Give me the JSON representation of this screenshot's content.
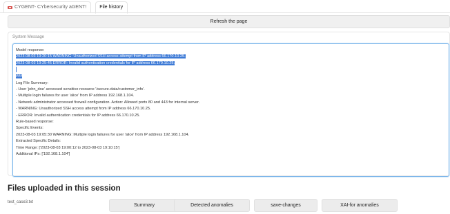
{
  "tabs": [
    {
      "label": "CYGENT- CYbersecurity aGENT!"
    },
    {
      "label": "File history"
    }
  ],
  "refresh": {
    "label": "Refresh the page"
  },
  "system_message": {
    "label": "System Message",
    "lines": [
      "Model response:",
      "2023-08-03 19:20:15 WARNING: Unauthorized SSH access attempt from IP address 66.170.10.25.",
      "2023-08-03 19:25:45 ERROR: Invalid authentication credentials for IP address 66.170.10.25.",
      "",
      "###",
      "",
      "Log File Summary:",
      "- User 'john_doe' accessed sensitive resource '/secure-data/customer_info'.",
      "- Multiple login failures for user 'alice' from IP address 192.168.1.104.",
      "- Network administrator accessed firewall configuration. Action: Allowed ports 80 and 443 for internal server.",
      "- WARNING: Unauthorized SSH access attempt from IP address 66.170.10.25.",
      "- ERROR: Invalid authentication credentials for IP address 66.170.10.25.",
      "",
      "Rule-based response:",
      "",
      "Specific Events:",
      "2023-08-03 19:05:30 WARNING: Multiple login failures for user 'alice' from IP address 192.168.1.104.",
      "",
      "Extracted Specific Details:",
      "Time Range: ['2023-08-03 19:00:12 to 2023-08-03 19:10:15']",
      "Additional IPs: ['192.168.1.104']"
    ]
  },
  "files_section": {
    "title": "Files uploaded in this session",
    "file_name": "test_case3.txt",
    "buttons": [
      "Summary",
      "Detected anomalies",
      "save-changes",
      "XAI-for anomalies"
    ]
  }
}
